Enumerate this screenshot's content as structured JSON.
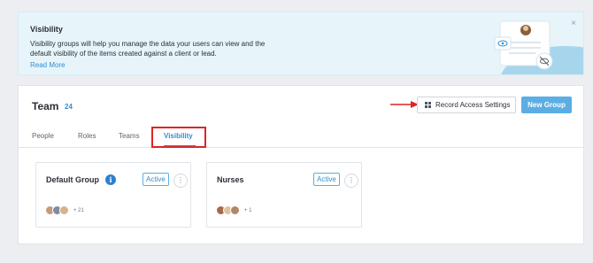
{
  "banner": {
    "title": "Visibility",
    "body": "Visibility groups will help you manage the data your users can view and the default visibility of the items created against a client or lead.",
    "link": "Read More",
    "close": "×"
  },
  "header": {
    "title": "Team",
    "count": "24",
    "record_access_label": "Record Access Settings",
    "new_group_label": "New Group"
  },
  "tabs": [
    {
      "label": "People",
      "active": false
    },
    {
      "label": "Roles",
      "active": false
    },
    {
      "label": "Teams",
      "active": false
    },
    {
      "label": "Visibility",
      "active": true
    }
  ],
  "groups": [
    {
      "name": "Default Group",
      "status": "Active",
      "more": "⋮",
      "member_count": "+ 21",
      "info": "i"
    },
    {
      "name": "Nurses",
      "status": "Active",
      "more": "⋮",
      "member_count": "+ 1"
    }
  ],
  "colors": {
    "accent": "#2f8fd0",
    "primary_button": "#5baee3",
    "highlight_box": "#e02424",
    "banner_bg": "#e7f5fb"
  }
}
